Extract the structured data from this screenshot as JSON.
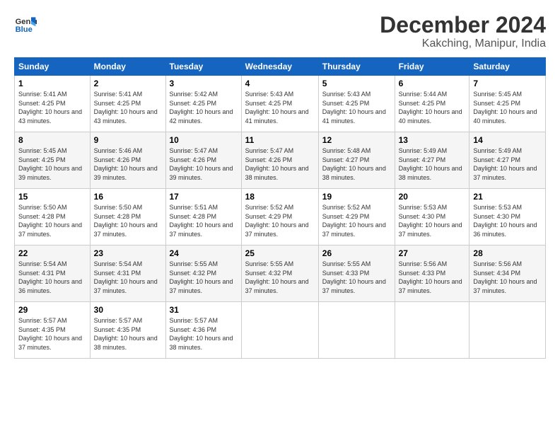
{
  "logo": {
    "line1": "General",
    "line2": "Blue"
  },
  "title": "December 2024",
  "location": "Kakching, Manipur, India",
  "weekdays": [
    "Sunday",
    "Monday",
    "Tuesday",
    "Wednesday",
    "Thursday",
    "Friday",
    "Saturday"
  ],
  "weeks": [
    [
      {
        "day": "1",
        "sunrise": "5:41 AM",
        "sunset": "4:25 PM",
        "daylight": "10 hours and 43 minutes."
      },
      {
        "day": "2",
        "sunrise": "5:41 AM",
        "sunset": "4:25 PM",
        "daylight": "10 hours and 43 minutes."
      },
      {
        "day": "3",
        "sunrise": "5:42 AM",
        "sunset": "4:25 PM",
        "daylight": "10 hours and 42 minutes."
      },
      {
        "day": "4",
        "sunrise": "5:43 AM",
        "sunset": "4:25 PM",
        "daylight": "10 hours and 41 minutes."
      },
      {
        "day": "5",
        "sunrise": "5:43 AM",
        "sunset": "4:25 PM",
        "daylight": "10 hours and 41 minutes."
      },
      {
        "day": "6",
        "sunrise": "5:44 AM",
        "sunset": "4:25 PM",
        "daylight": "10 hours and 40 minutes."
      },
      {
        "day": "7",
        "sunrise": "5:45 AM",
        "sunset": "4:25 PM",
        "daylight": "10 hours and 40 minutes."
      }
    ],
    [
      {
        "day": "8",
        "sunrise": "5:45 AM",
        "sunset": "4:25 PM",
        "daylight": "10 hours and 39 minutes."
      },
      {
        "day": "9",
        "sunrise": "5:46 AM",
        "sunset": "4:26 PM",
        "daylight": "10 hours and 39 minutes."
      },
      {
        "day": "10",
        "sunrise": "5:47 AM",
        "sunset": "4:26 PM",
        "daylight": "10 hours and 39 minutes."
      },
      {
        "day": "11",
        "sunrise": "5:47 AM",
        "sunset": "4:26 PM",
        "daylight": "10 hours and 38 minutes."
      },
      {
        "day": "12",
        "sunrise": "5:48 AM",
        "sunset": "4:27 PM",
        "daylight": "10 hours and 38 minutes."
      },
      {
        "day": "13",
        "sunrise": "5:49 AM",
        "sunset": "4:27 PM",
        "daylight": "10 hours and 38 minutes."
      },
      {
        "day": "14",
        "sunrise": "5:49 AM",
        "sunset": "4:27 PM",
        "daylight": "10 hours and 37 minutes."
      }
    ],
    [
      {
        "day": "15",
        "sunrise": "5:50 AM",
        "sunset": "4:28 PM",
        "daylight": "10 hours and 37 minutes."
      },
      {
        "day": "16",
        "sunrise": "5:50 AM",
        "sunset": "4:28 PM",
        "daylight": "10 hours and 37 minutes."
      },
      {
        "day": "17",
        "sunrise": "5:51 AM",
        "sunset": "4:28 PM",
        "daylight": "10 hours and 37 minutes."
      },
      {
        "day": "18",
        "sunrise": "5:52 AM",
        "sunset": "4:29 PM",
        "daylight": "10 hours and 37 minutes."
      },
      {
        "day": "19",
        "sunrise": "5:52 AM",
        "sunset": "4:29 PM",
        "daylight": "10 hours and 37 minutes."
      },
      {
        "day": "20",
        "sunrise": "5:53 AM",
        "sunset": "4:30 PM",
        "daylight": "10 hours and 37 minutes."
      },
      {
        "day": "21",
        "sunrise": "5:53 AM",
        "sunset": "4:30 PM",
        "daylight": "10 hours and 36 minutes."
      }
    ],
    [
      {
        "day": "22",
        "sunrise": "5:54 AM",
        "sunset": "4:31 PM",
        "daylight": "10 hours and 36 minutes."
      },
      {
        "day": "23",
        "sunrise": "5:54 AM",
        "sunset": "4:31 PM",
        "daylight": "10 hours and 37 minutes."
      },
      {
        "day": "24",
        "sunrise": "5:55 AM",
        "sunset": "4:32 PM",
        "daylight": "10 hours and 37 minutes."
      },
      {
        "day": "25",
        "sunrise": "5:55 AM",
        "sunset": "4:32 PM",
        "daylight": "10 hours and 37 minutes."
      },
      {
        "day": "26",
        "sunrise": "5:55 AM",
        "sunset": "4:33 PM",
        "daylight": "10 hours and 37 minutes."
      },
      {
        "day": "27",
        "sunrise": "5:56 AM",
        "sunset": "4:33 PM",
        "daylight": "10 hours and 37 minutes."
      },
      {
        "day": "28",
        "sunrise": "5:56 AM",
        "sunset": "4:34 PM",
        "daylight": "10 hours and 37 minutes."
      }
    ],
    [
      {
        "day": "29",
        "sunrise": "5:57 AM",
        "sunset": "4:35 PM",
        "daylight": "10 hours and 37 minutes."
      },
      {
        "day": "30",
        "sunrise": "5:57 AM",
        "sunset": "4:35 PM",
        "daylight": "10 hours and 38 minutes."
      },
      {
        "day": "31",
        "sunrise": "5:57 AM",
        "sunset": "4:36 PM",
        "daylight": "10 hours and 38 minutes."
      },
      null,
      null,
      null,
      null
    ]
  ],
  "labels": {
    "sunrise": "Sunrise:",
    "sunset": "Sunset:",
    "daylight": "Daylight:"
  }
}
